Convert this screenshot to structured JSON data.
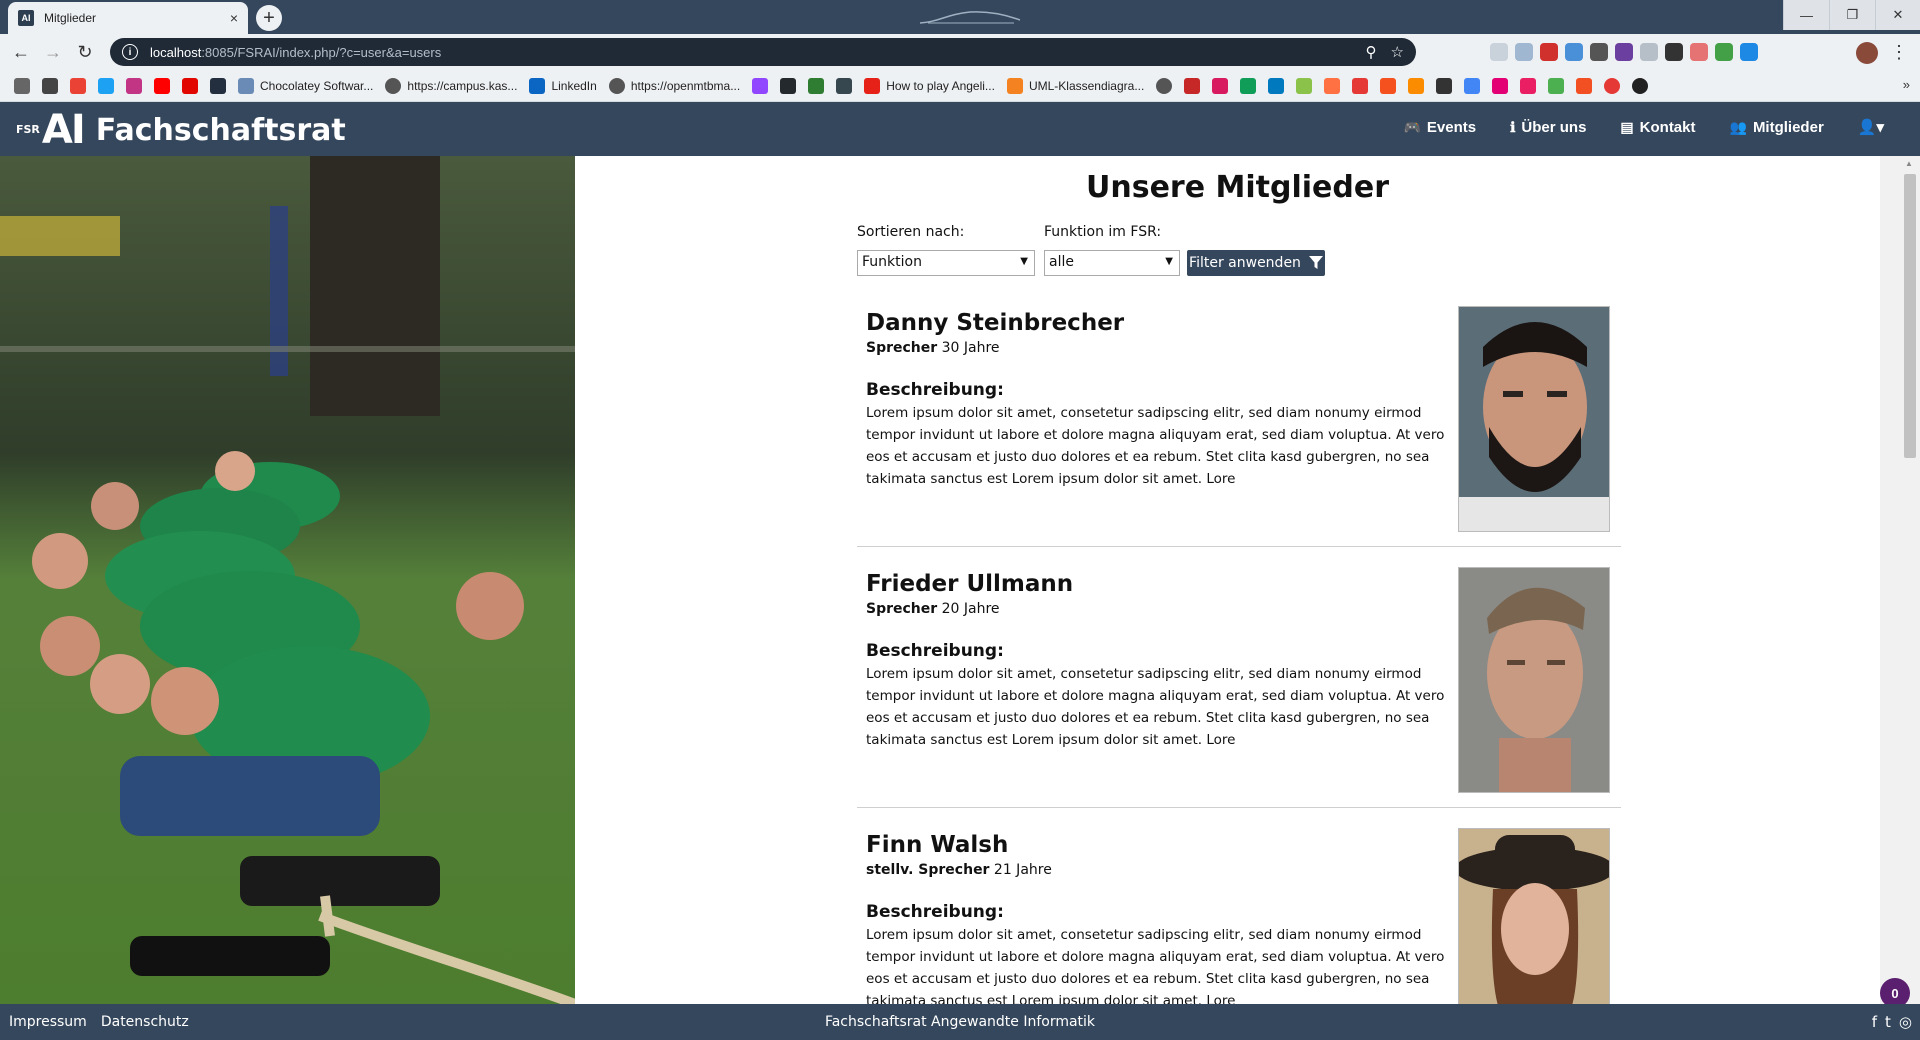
{
  "browser": {
    "tab_title": "Mitglieder",
    "tab_favicon_text": "AI",
    "close_glyph": "×",
    "newtab_glyph": "+",
    "url_host": "localhost",
    "url_rest": ":8085/FSRAI/index.php/?c=user&a=users",
    "window_controls": [
      "—",
      "❐",
      "✕"
    ],
    "bookmarks": [
      {
        "label": "Chocolatey Softwar...",
        "color": "#6a8bb5"
      },
      {
        "label": "https://campus.kas...",
        "color": "#555"
      },
      {
        "label": "LinkedIn",
        "color": "#0a66c2"
      },
      {
        "label": "https://openmtbma...",
        "color": "#555"
      },
      {
        "label": "How to play Angeli...",
        "color": "#e62117"
      },
      {
        "label": "UML-Klassendiagra...",
        "color": "#f58220"
      }
    ]
  },
  "site": {
    "logo_small": "FSR",
    "logo_mark": "AI",
    "logo_text": "Fachschaftsrat",
    "nav": [
      {
        "label": "Events",
        "icon": "gamepad-icon",
        "glyph": "🎮"
      },
      {
        "label": "Über uns",
        "icon": "info-icon",
        "glyph": "ℹ"
      },
      {
        "label": "Kontakt",
        "icon": "contact-card-icon",
        "glyph": "▤"
      },
      {
        "label": "Mitglieder",
        "icon": "users-icon",
        "glyph": "👥"
      }
    ],
    "user_menu_glyph": "👤▾"
  },
  "main": {
    "title": "Unsere Mitglieder",
    "filters": {
      "sort_label": "Sortieren nach:",
      "sort_value": "Funktion",
      "function_label": "Funktion im FSR:",
      "function_value": "alle",
      "apply_label": "Filter anwenden"
    },
    "members": [
      {
        "name": "Danny Steinbrecher",
        "role": "Sprecher",
        "age": "30 Jahre",
        "desc_heading": "Beschreibung:",
        "description": "Lorem ipsum dolor sit amet, consetetur sadipscing elitr, sed diam nonumy eirmod tempor invidunt ut labore et dolore magna aliquyam erat, sed diam voluptua. At vero eos et accusam et justo duo dolores et ea rebum. Stet clita kasd gubergren, no sea takimata sanctus est Lorem ipsum dolor sit amet. Lore"
      },
      {
        "name": "Frieder Ullmann",
        "role": "Sprecher",
        "age": "20 Jahre",
        "desc_heading": "Beschreibung:",
        "description": "Lorem ipsum dolor sit amet, consetetur sadipscing elitr, sed diam nonumy eirmod tempor invidunt ut labore et dolore magna aliquyam erat, sed diam voluptua. At vero eos et accusam et justo duo dolores et ea rebum. Stet clita kasd gubergren, no sea takimata sanctus est Lorem ipsum dolor sit amet. Lore"
      },
      {
        "name": "Finn Walsh",
        "role": "stellv. Sprecher",
        "age": "21 Jahre",
        "desc_heading": "Beschreibung:",
        "description": "Lorem ipsum dolor sit amet, consetetur sadipscing elitr, sed diam nonumy eirmod tempor invidunt ut labore et dolore magna aliquyam erat, sed diam voluptua. At vero eos et accusam et justo duo dolores et ea rebum. Stet clita kasd gubergren, no sea takimata sanctus est Lorem ipsum dolor sit amet. Lore"
      }
    ],
    "notification_count": "0"
  },
  "footer": {
    "impressum": "Impressum",
    "datenschutz": "Datenschutz",
    "center_text": "Fachschaftsrat Angewandte Informatik",
    "social": [
      "f",
      "t",
      "◎"
    ]
  },
  "colors": {
    "brand": "#35475c",
    "hero_grass": "#3d6b2d",
    "jersey_green": "#1f8a4c"
  }
}
